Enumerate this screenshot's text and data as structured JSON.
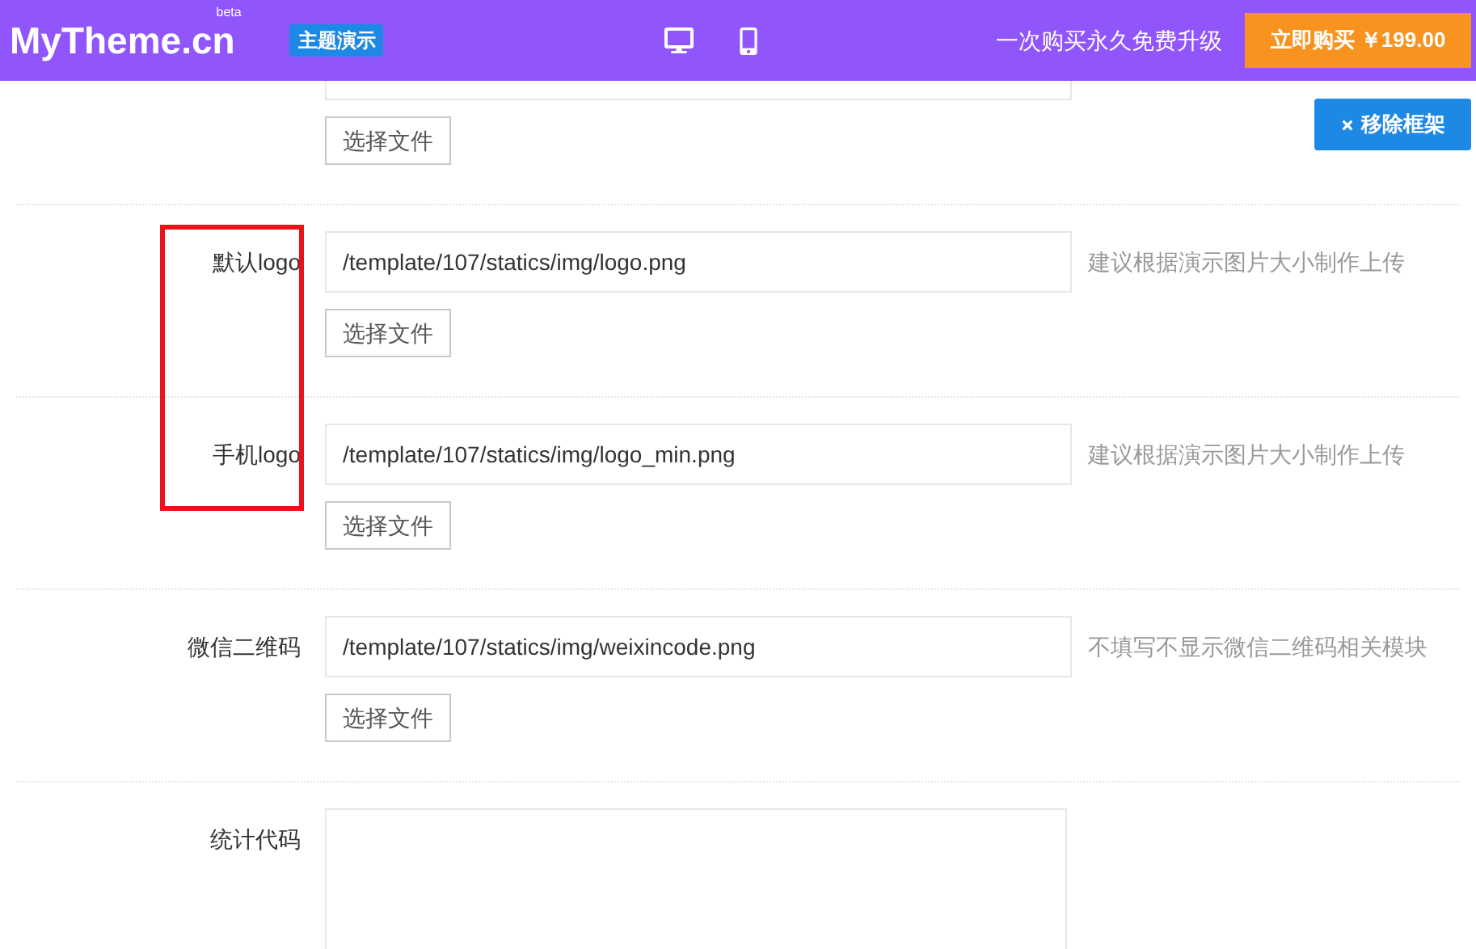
{
  "header": {
    "logo": "MyTheme.cn",
    "logo_badge": "beta",
    "demo_badge": "主题演示",
    "promo": "一次购买永久免费升级",
    "buy_button": "立即购买 ￥199.00"
  },
  "remove_frame_button": "移除框架",
  "highlight_box": true,
  "rows": [
    {
      "kind": "file",
      "button": "选择文件"
    },
    {
      "kind": "file",
      "label": "默认logo",
      "value": "/template/107/statics/img/logo.png",
      "hint": "建议根据演示图片大小制作上传",
      "button": "选择文件"
    },
    {
      "kind": "file",
      "label": "手机logo",
      "value": "/template/107/statics/img/logo_min.png",
      "hint": "建议根据演示图片大小制作上传",
      "button": "选择文件"
    },
    {
      "kind": "file",
      "label": "微信二维码",
      "value": "/template/107/statics/img/weixincode.png",
      "hint": "不填写不显示微信二维码相关模块",
      "button": "选择文件"
    },
    {
      "kind": "textarea",
      "label": "统计代码"
    }
  ]
}
